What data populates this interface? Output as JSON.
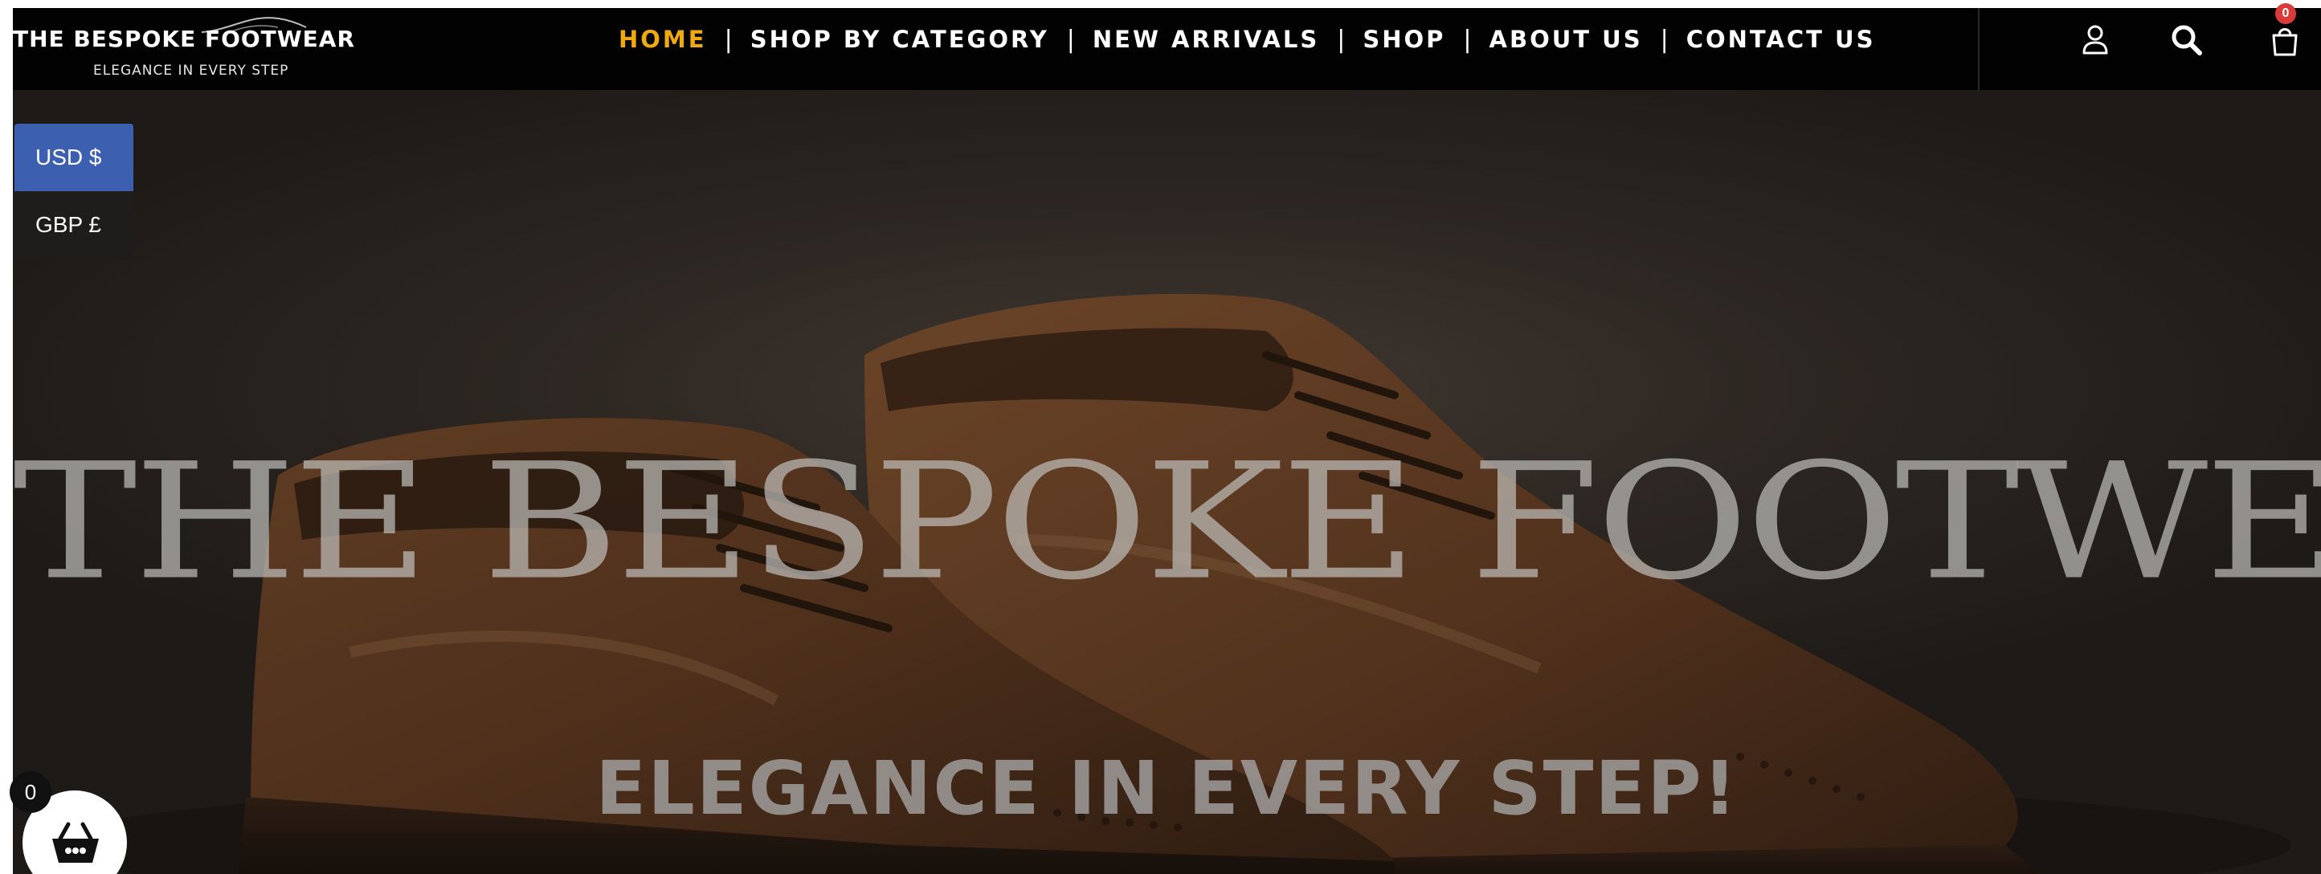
{
  "header": {
    "logo": {
      "title": "THE BESPOKE FOOTWEAR",
      "tagline": "ELEGANCE IN EVERY STEP"
    },
    "nav": [
      {
        "label": "HOME",
        "active": true
      },
      {
        "label": "SHOP BY CATEGORY",
        "active": false
      },
      {
        "label": "NEW ARRIVALS",
        "active": false
      },
      {
        "label": "SHOP",
        "active": false
      },
      {
        "label": "ABOUT US",
        "active": false
      },
      {
        "label": "CONTACT US",
        "active": false
      }
    ],
    "nav_separator": "|",
    "icons": [
      "user-icon",
      "search-icon",
      "cart-icon"
    ],
    "cart_count": "0"
  },
  "currency": {
    "options": [
      "USD $",
      "GBP £"
    ],
    "selected": "USD $"
  },
  "hero": {
    "title": "THE BESPOKE FOOTWEAR",
    "subtitle": "ELEGANCE IN EVERY STEP!"
  },
  "basket": {
    "count": "0",
    "icon": "basket-icon"
  },
  "colors": {
    "header_bg": "#020202",
    "nav_active": "#f0a90f",
    "nav_text": "#ffffff",
    "currency_selected": "#3d5fb0",
    "cart_badge": "#d93a3a",
    "shoe_leather": "#6b3f22"
  }
}
